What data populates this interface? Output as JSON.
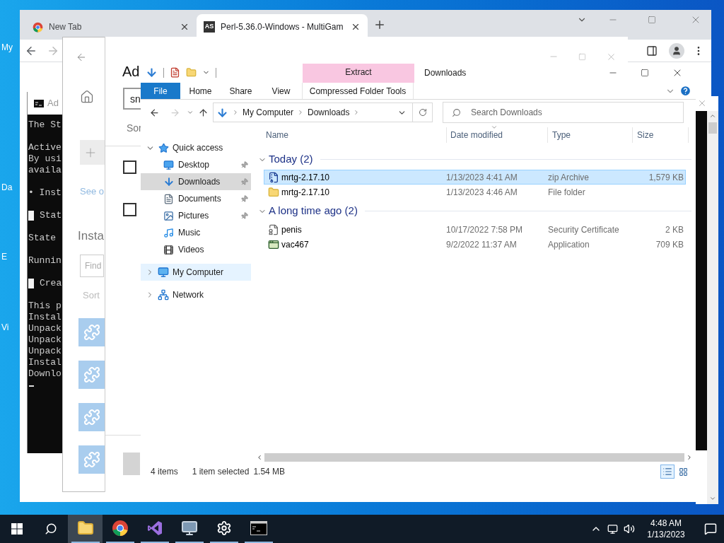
{
  "desktop": {
    "icon_labels": [
      "My",
      "Da",
      "E",
      "Vi"
    ]
  },
  "browser": {
    "tabs": [
      {
        "label": "New Tab",
        "selected": false
      },
      {
        "label": "Perl-5.36.0-Windows - MultiGam",
        "favicon": "AS",
        "selected": true
      }
    ]
  },
  "console": {
    "title": "Ad",
    "paragraphs": [
      [
        {
          "text": "The St",
          "boxed": false
        }
      ],
      [
        {
          "text": "Active",
          "boxed": false
        },
        {
          "text": "By usi",
          "boxed": false
        },
        {
          "text": "availa",
          "boxed": false
        }
      ],
      [
        {
          "text": "• Inst",
          "boxed": false
        }
      ],
      [
        {
          "text": "Stat",
          "boxed": true
        }
      ],
      [
        {
          "text": "State",
          "boxed": false
        }
      ],
      [
        {
          "text": "Runnin",
          "boxed": false
        }
      ],
      [
        {
          "text": "Crea",
          "boxed": true
        }
      ],
      [
        {
          "text": "This p",
          "boxed": false
        },
        {
          "text": "Instal",
          "boxed": false
        },
        {
          "text": "Unpack",
          "boxed": false
        },
        {
          "text": "Unpack",
          "boxed": false
        },
        {
          "text": "Unpack",
          "boxed": false
        },
        {
          "text": "Instal",
          "boxed": false
        },
        {
          "text": "Downlo",
          "boxed": false
        }
      ]
    ]
  },
  "settings_back": {
    "link": "See o",
    "heading": "Insta",
    "find_placeholder": "Find",
    "sort_label": "Sort"
  },
  "settings_front": {
    "title": "Ad",
    "search_value": "sn",
    "sort_label": "Sor",
    "checkboxes": [
      {
        "checked": false
      },
      {
        "checked": false
      }
    ]
  },
  "explorer": {
    "title": "Downloads",
    "context_header": "Extract",
    "ribbon_tabs": [
      {
        "label": "File",
        "kind": "file"
      },
      {
        "label": "Home",
        "kind": "tab"
      },
      {
        "label": "Share",
        "kind": "tab"
      },
      {
        "label": "View",
        "kind": "tab"
      },
      {
        "label": "Compressed Folder Tools",
        "kind": "context"
      }
    ],
    "breadcrumb": [
      "My Computer",
      "Downloads"
    ],
    "search_placeholder": "Search Downloads",
    "nav": [
      {
        "label": "Quick access",
        "kind": "quick",
        "expanded": true,
        "hovered": false,
        "selected": false,
        "children": [
          {
            "label": "Desktop",
            "kind": "desktop",
            "pinned": true,
            "selected": false
          },
          {
            "label": "Downloads",
            "kind": "downloads",
            "pinned": true,
            "selected": true
          },
          {
            "label": "Documents",
            "kind": "documents",
            "pinned": true,
            "selected": false
          },
          {
            "label": "Pictures",
            "kind": "pictures",
            "pinned": true,
            "selected": false
          },
          {
            "label": "Music",
            "kind": "music",
            "pinned": false,
            "selected": false
          },
          {
            "label": "Videos",
            "kind": "videos",
            "pinned": false,
            "selected": false
          }
        ]
      },
      {
        "label": "My Computer",
        "kind": "computer",
        "expanded": false,
        "hovered": true,
        "selected": false
      },
      {
        "label": "Network",
        "kind": "network",
        "expanded": false,
        "hovered": false,
        "selected": false
      }
    ],
    "columns": [
      {
        "label": "Name",
        "sorted": false
      },
      {
        "label": "Date modified",
        "sorted": true
      },
      {
        "label": "Type",
        "sorted": false
      },
      {
        "label": "Size",
        "sorted": false
      }
    ],
    "groups": [
      {
        "label": "Today (2)",
        "expanded": true,
        "rows": [
          {
            "name": "mrtg-2.17.10",
            "kind": "zip",
            "date": "1/13/2023 4:41 AM",
            "type": "zip Archive",
            "size": "1,579 KB",
            "selected": true
          },
          {
            "name": "mrtg-2.17.10",
            "kind": "folder",
            "date": "1/13/2023 4:46 AM",
            "type": "File folder",
            "selected": false
          }
        ]
      },
      {
        "label": "A long time ago (2)",
        "expanded": true,
        "rows": [
          {
            "name": "penis",
            "kind": "certificate",
            "date": "10/17/2022 7:58 PM",
            "type": "Security Certificate",
            "size": "2 KB",
            "selected": false
          },
          {
            "name": "vac467",
            "kind": "application",
            "date": "9/2/2022 11:37 AM",
            "type": "Application",
            "size": "709 KB",
            "selected": false
          }
        ]
      }
    ],
    "status": {
      "count": "4 items",
      "selection": "1 item selected",
      "size": "1.54 MB"
    },
    "views": [
      {
        "kind": "details",
        "selected": true
      },
      {
        "kind": "thumbnails",
        "selected": false
      }
    ]
  },
  "taskbar": {
    "apps": [
      {
        "kind": "explorer",
        "active": true
      },
      {
        "kind": "chrome",
        "active": false
      },
      {
        "kind": "studio",
        "active": false
      },
      {
        "kind": "monitor",
        "active": false
      },
      {
        "kind": "settings",
        "active": false
      },
      {
        "kind": "terminal",
        "active": false
      }
    ],
    "time": "4:48 AM",
    "date": "1/13/2023"
  }
}
